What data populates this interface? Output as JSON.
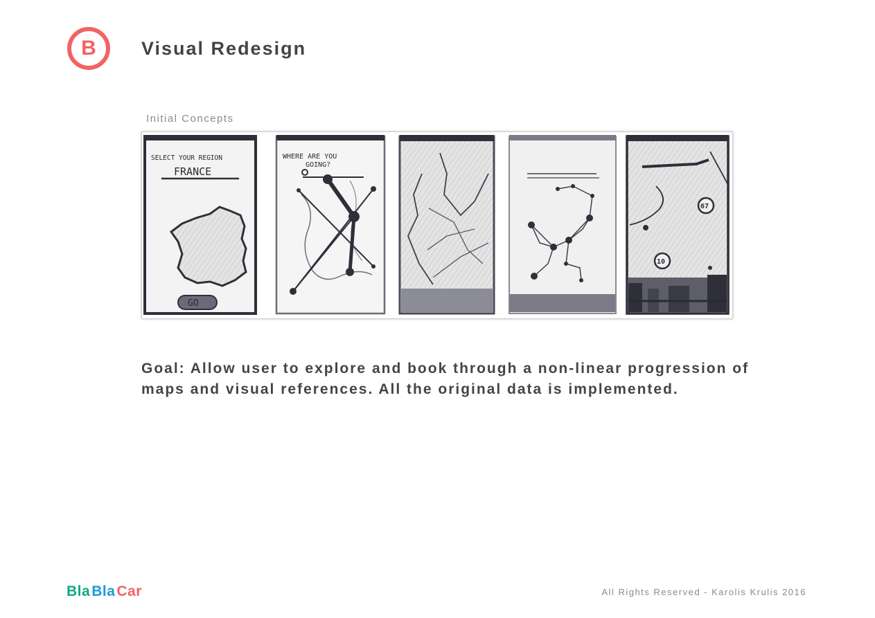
{
  "header": {
    "section_letter": "B",
    "title": "Visual Redesign"
  },
  "concepts": {
    "caption": "Initial Concepts",
    "sketches": [
      {
        "line1": "SELECT YOUR REGION",
        "line2": "FRANCE",
        "button": "GO"
      },
      {
        "line1": "WHERE ARE YOU",
        "line2": "GOING?"
      },
      {},
      {},
      {
        "badge1": "67",
        "badge2": "10"
      }
    ]
  },
  "goal": "Goal: Allow user to explore and book through a non-linear progression of maps and visual references. All the original data is implemented.",
  "footer": {
    "logo_part1": "Bla",
    "logo_part2": "Bla",
    "logo_part3": "Car",
    "copyright": "All Rights Reserved - Karolis Krulis 2016"
  },
  "colors": {
    "accent": "#f26363",
    "logo_green": "#12a883",
    "logo_blue": "#1e9bd7"
  }
}
